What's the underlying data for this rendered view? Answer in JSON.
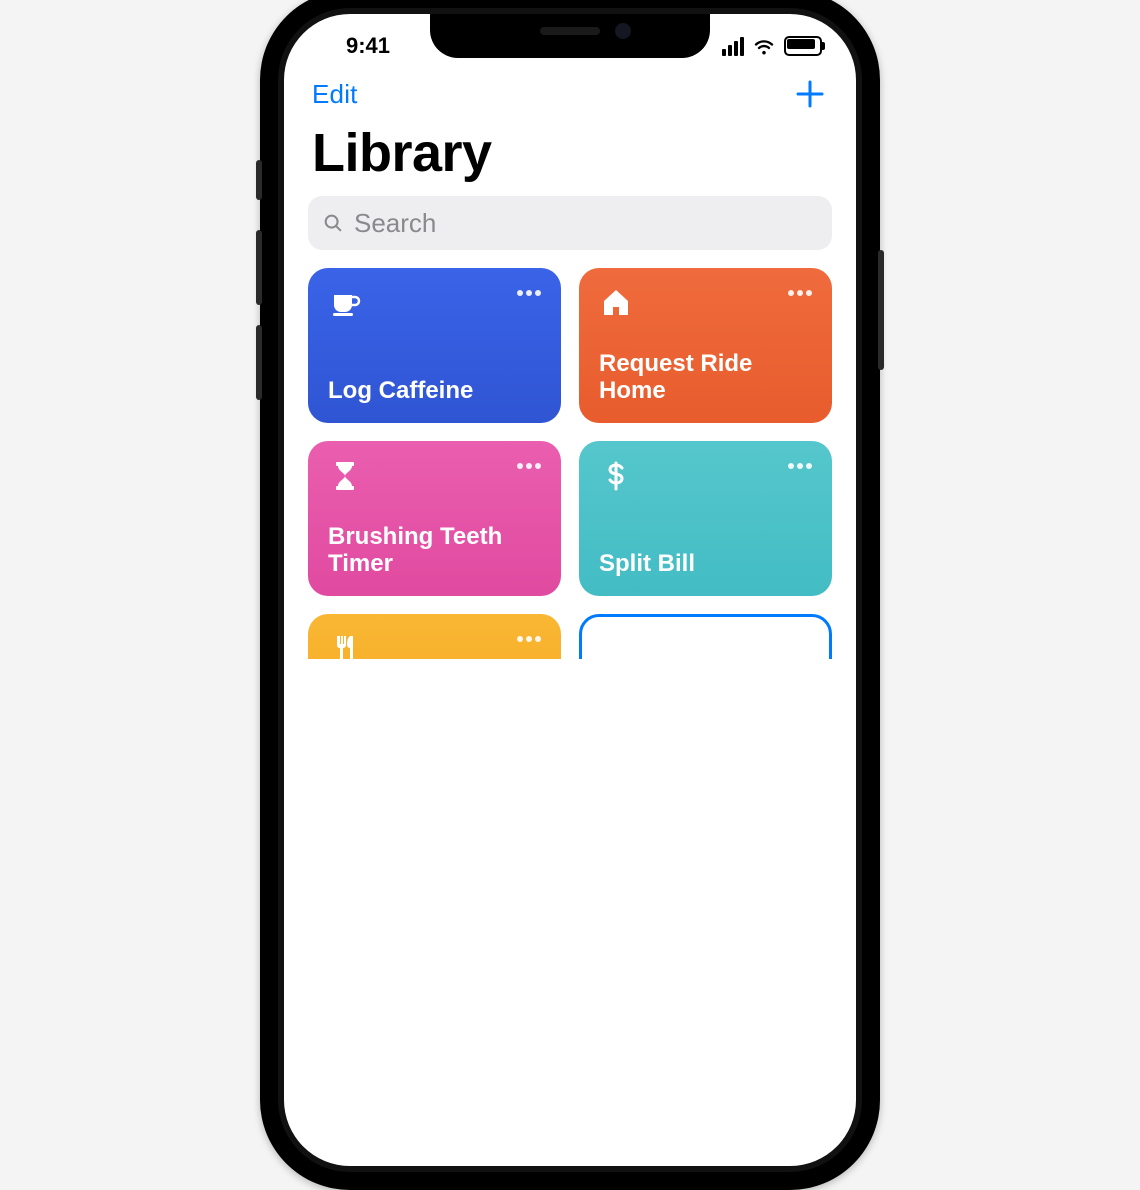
{
  "status": {
    "time": "9:41"
  },
  "nav": {
    "edit_label": "Edit"
  },
  "page": {
    "title": "Library"
  },
  "search": {
    "placeholder": "Search"
  },
  "cards": [
    {
      "id": "log-caffeine",
      "label": "Log Caffeine",
      "icon": "coffee-cup-icon",
      "color": "blue"
    },
    {
      "id": "request-ride-home",
      "label": "Request Ride Home",
      "icon": "home-icon",
      "color": "orange"
    },
    {
      "id": "brushing-teeth",
      "label": "Brushing Teeth Timer",
      "icon": "hourglass-icon",
      "color": "pink"
    },
    {
      "id": "split-bill",
      "label": "Split Bill",
      "icon": "dollar-icon",
      "color": "teal"
    },
    {
      "id": "card5",
      "label": "",
      "icon": "utensils-icon",
      "color": "yellow"
    },
    {
      "id": "create-shortcut",
      "label": "",
      "icon": "plus-icon",
      "color": "white"
    }
  ],
  "colors": {
    "accent": "#007aff"
  }
}
